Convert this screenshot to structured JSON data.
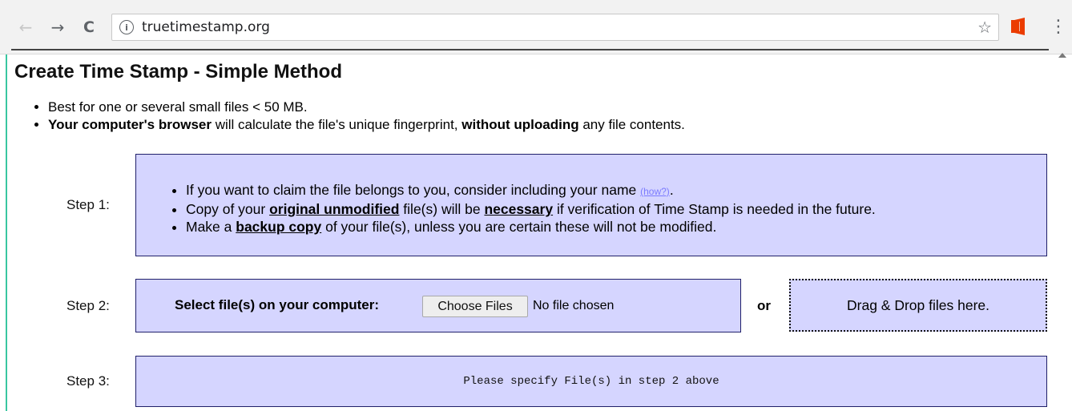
{
  "browser": {
    "url": "truetimestamp.org",
    "back_glyph": "←",
    "forward_glyph": "→",
    "reload_glyph": "C",
    "info_glyph": "i",
    "star_glyph": "☆",
    "menu_glyph": "⋮",
    "icons": [
      "back-icon",
      "forward-icon",
      "reload-icon",
      "info-icon",
      "star-icon",
      "office-icon",
      "menu-icon"
    ]
  },
  "page": {
    "title": "Create Time Stamp - Simple Method",
    "intro": {
      "item1": "Best for one or several small files < 50 MB.",
      "item2_bold1": "Your computer's browser",
      "item2_text1": " will calculate the file's unique fingerprint, ",
      "item2_bold2": "without uploading",
      "item2_text2": " any file contents."
    },
    "step1": {
      "label": "Step 1:",
      "line1_text": "If you want to claim the file belongs to you, consider including your name ",
      "line1_link": "(how?)",
      "line1_end": ".",
      "line2_a": "Copy of your ",
      "line2_bold1": "original unmodified",
      "line2_b": " file(s) will be ",
      "line2_bold2": "necessary",
      "line2_c": " if verification of Time Stamp is needed in the future.",
      "line3_a": "Make a ",
      "line3_bold": "backup copy",
      "line3_b": " of your file(s), unless you are certain these will not be modified."
    },
    "step2": {
      "label": "Step 2:",
      "select_label": "Select file(s) on your computer:",
      "choose_button": "Choose Files",
      "no_file": "No file chosen",
      "or": "or",
      "dropzone": "Drag & Drop files here."
    },
    "step3": {
      "label": "Step 3:",
      "message": "Please specify File(s) in step 2 above"
    }
  },
  "colors": {
    "box_fill": "#d5d5ff",
    "box_border": "#20206a",
    "link": "#7b7bff",
    "accent": "#39c6a0",
    "office_logo": "#eb3c00"
  }
}
